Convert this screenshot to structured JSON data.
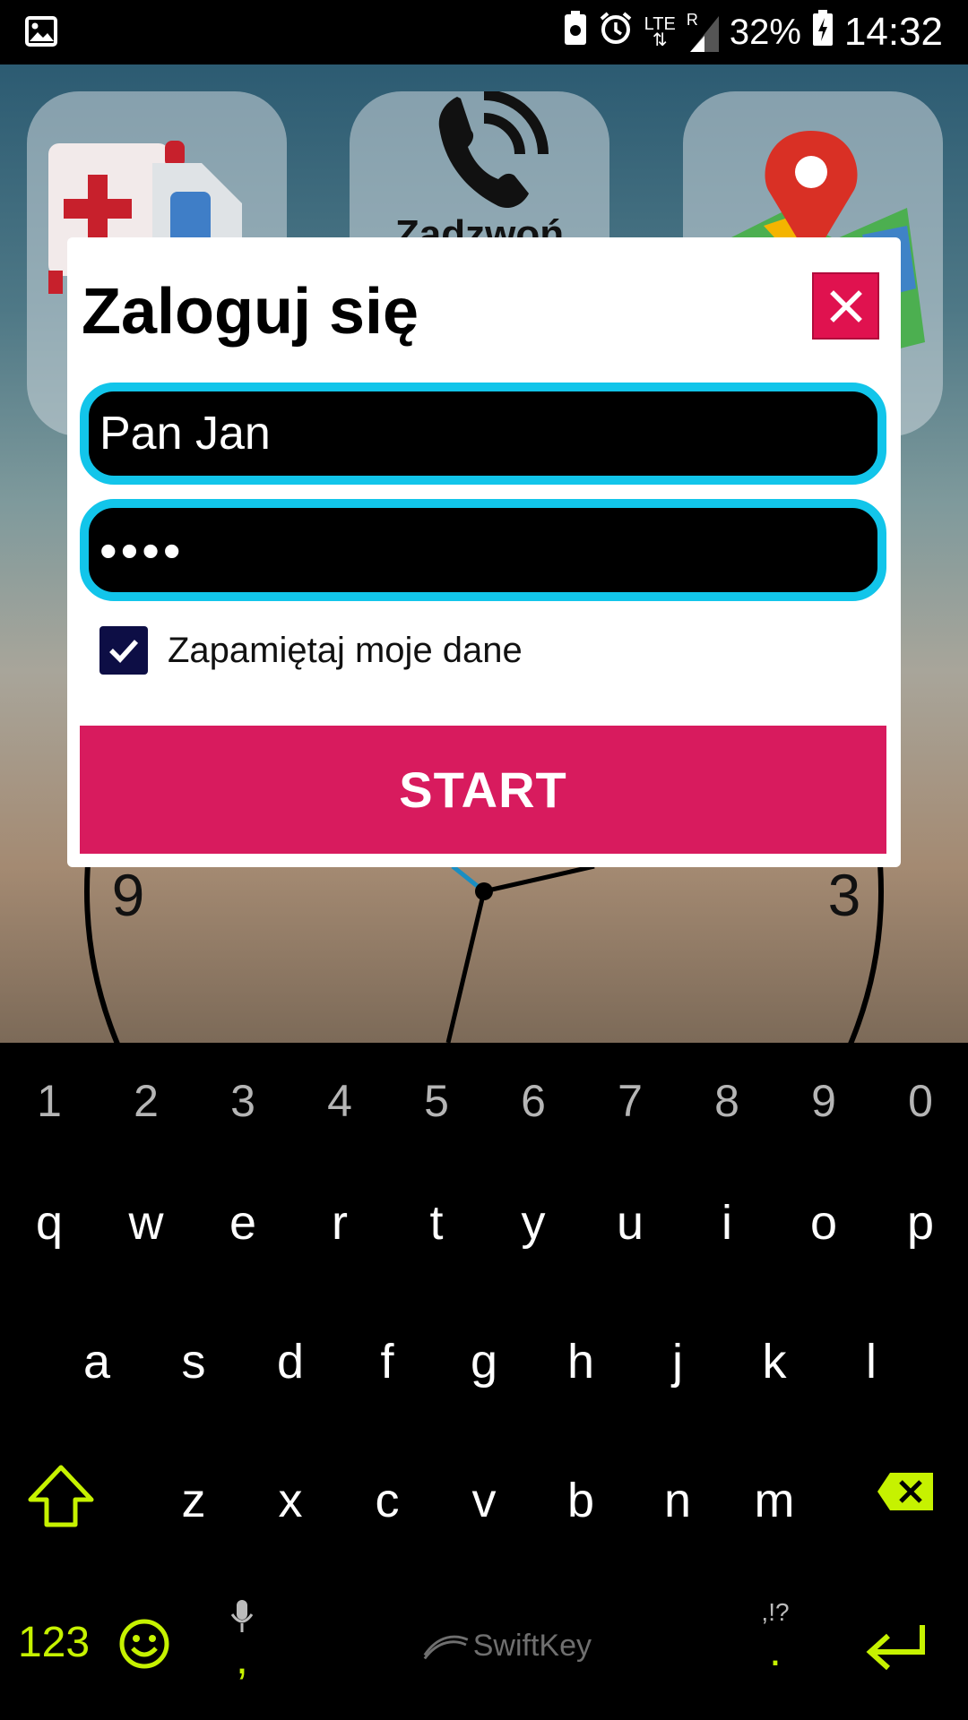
{
  "status_bar": {
    "network_label": "LTE",
    "roaming_label": "R",
    "battery_percent": "32%",
    "time": "14:32",
    "icons": [
      "picture-icon",
      "battery-saver-icon",
      "alarm-icon",
      "lte-signal-icon",
      "signal-icon",
      "battery-charging-icon"
    ]
  },
  "home": {
    "tiles": [
      {
        "name": "first-aid-kit-tile",
        "label": ""
      },
      {
        "name": "call-tile",
        "label": "Zadzwoń"
      },
      {
        "name": "maps-tile",
        "label": ""
      }
    ],
    "clock": {
      "label_9": "9",
      "label_3": "3"
    }
  },
  "dialog": {
    "title": "Zaloguj się",
    "username_value": "Pan Jan",
    "password_value": "••••",
    "remember_label": "Zapamiętaj moje dane",
    "remember_checked": true,
    "start_label": "START",
    "accent_color": "#12c5ea",
    "button_color": "#d81b5e",
    "close_color": "#e0124f"
  },
  "keyboard": {
    "number_row": [
      "1",
      "2",
      "3",
      "4",
      "5",
      "6",
      "7",
      "8",
      "9",
      "0"
    ],
    "row1": [
      "q",
      "w",
      "e",
      "r",
      "t",
      "y",
      "u",
      "i",
      "o",
      "p"
    ],
    "row2": [
      "a",
      "s",
      "d",
      "f",
      "g",
      "h",
      "j",
      "k",
      "l"
    ],
    "row3": [
      "z",
      "x",
      "c",
      "v",
      "b",
      "n",
      "m"
    ],
    "symbols_label": "123",
    "comma_label": ",",
    "period_label": ".",
    "punct_hint": ",!?",
    "brand": "SwiftKey",
    "accent_color": "#c6f200"
  }
}
